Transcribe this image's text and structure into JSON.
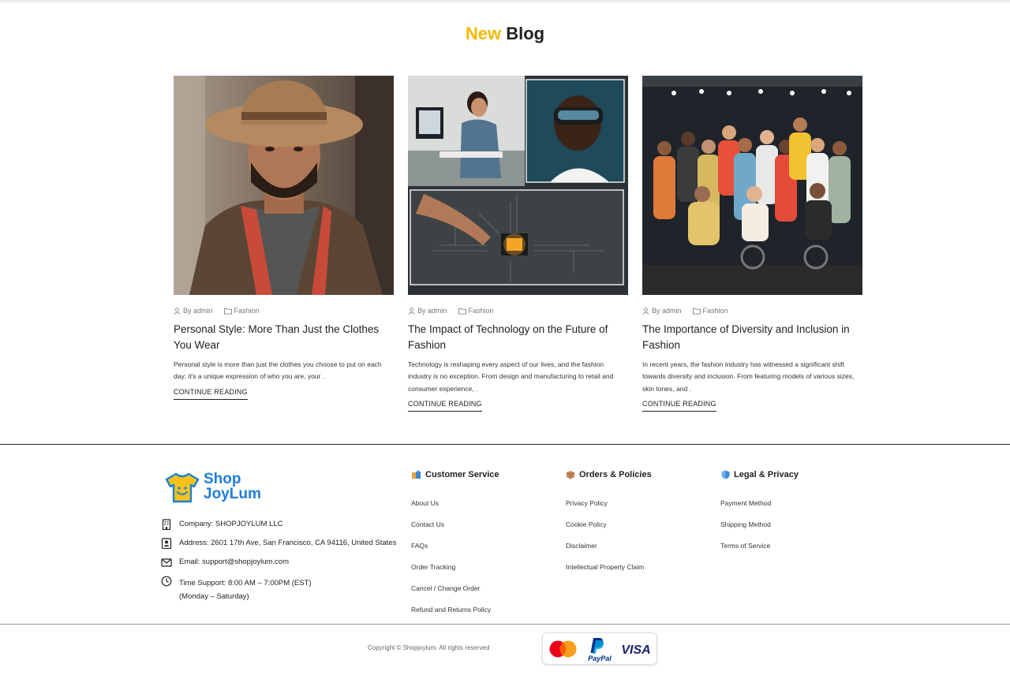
{
  "blog": {
    "title_accent": "New",
    "title_rest": " Blog",
    "posts": [
      {
        "author": "By admin",
        "category": "Fashion",
        "title": "Personal Style: More Than Just the Clothes You Wear",
        "excerpt": "Personal style is more than just the clothes you choose to put on each day; it's a unique expression of who you are, your .",
        "cta": "CONTINUE READING",
        "image": "photo-man-in-hat"
      },
      {
        "author": "By admin",
        "category": "Fashion",
        "title": "The Impact of Technology on the Future of Fashion",
        "excerpt": "Technology is reshaping every aspect of our lives, and the fashion industry is no exception. From design and manufacturing to retail and consumer experience, .",
        "cta": "CONTINUE READING",
        "image": "photo-technology-collage"
      },
      {
        "author": "By admin",
        "category": "Fashion",
        "title": "The Importance of Diversity and Inclusion in Fashion",
        "excerpt": "In recent years, the fashion industry has witnessed a significant shift towards diversity and inclusion. From featuring models of various sizes, skin tones, and .",
        "cta": "CONTINUE READING",
        "image": "photo-diverse-group"
      }
    ]
  },
  "footer": {
    "logo_line1": "Shop",
    "logo_line2": "JoyLum",
    "company": "Company: SHOPJOYLUM LLC",
    "address": "Address: 2601 17th Ave, San Francisco, CA 94116, United States",
    "email": "Email: support@shopjoylum.com",
    "time_line1": "Time Support: 8:00 AM – 7:00PM (EST)",
    "time_line2": "(Monday – Saturday)",
    "columns": [
      {
        "heading": "Customer Service",
        "icon": "shopping-bags-icon",
        "links": [
          "About Us",
          "Contact Us",
          "FAQs",
          "Order Tracking",
          "Cancel / Change Order",
          "Refund and Returns Policy"
        ]
      },
      {
        "heading": "Orders & Policies",
        "icon": "package-icon",
        "links": [
          "Privacy Policy",
          "Cookie Policy",
          "Disclaimer",
          "Intellectual Property Claim"
        ]
      },
      {
        "heading": "Legal & Privacy",
        "icon": "shield-icon",
        "links": [
          "Payment Method",
          "Shipping Method",
          "Terms of Service"
        ]
      }
    ],
    "copyright": "Copyright © Shopjoylum. All rights reserved",
    "payment": {
      "paypal": "PayPal",
      "visa": "VISA",
      "icons": [
        "mastercard-icon",
        "paypal-icon",
        "visa-icon"
      ]
    }
  },
  "colors": {
    "accent": "#f5b800",
    "brand_blue": "#1d7fd6",
    "mastercard_red": "#eb001b",
    "mastercard_orange": "#f79e1b",
    "paypal_navy": "#003087",
    "paypal_blue": "#009cde",
    "visa_navy": "#1a1f71"
  }
}
